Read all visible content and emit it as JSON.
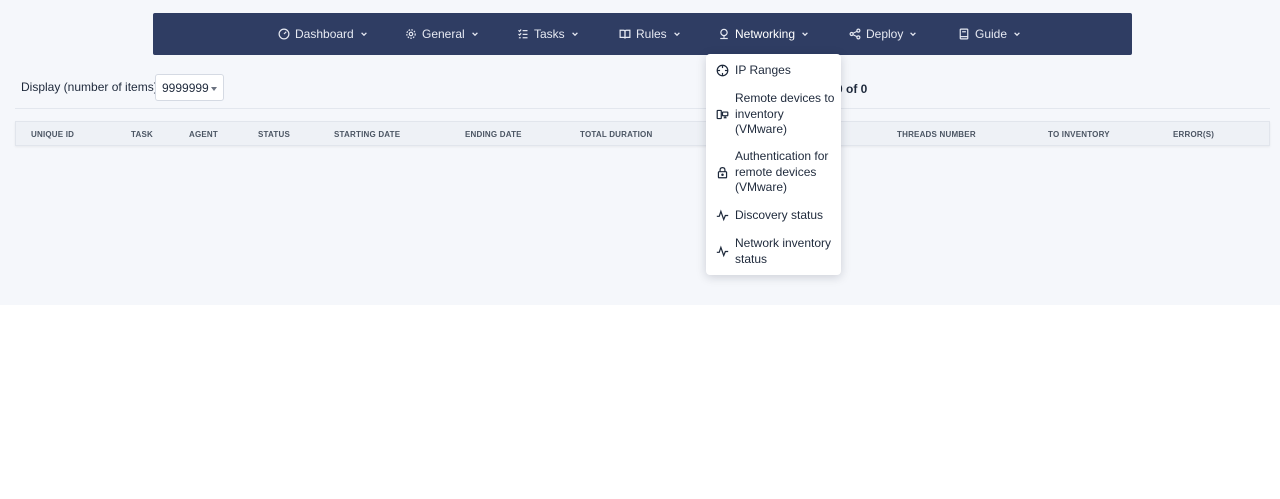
{
  "nav": {
    "items": [
      {
        "label": "Dashboard",
        "icon": "gauge-icon"
      },
      {
        "label": "General",
        "icon": "gear-icon"
      },
      {
        "label": "Tasks",
        "icon": "checklist-icon"
      },
      {
        "label": "Rules",
        "icon": "book-icon"
      },
      {
        "label": "Networking",
        "icon": "network-icon"
      },
      {
        "label": "Deploy",
        "icon": "share-icon"
      },
      {
        "label": "Guide",
        "icon": "guide-book-icon"
      }
    ],
    "active": "Networking"
  },
  "display": {
    "label": "Display (number of items)",
    "selected": "9999999"
  },
  "pager": {
    "text": "0 of 0"
  },
  "table": {
    "columns": [
      "UNIQUE ID",
      "TASK",
      "AGENT",
      "STATUS",
      "STARTING DATE",
      "ENDING DATE",
      "TOTAL DURATION",
      "THREADS NUMBER",
      "TO INVENTORY",
      "ERROR(S)"
    ]
  },
  "networking_menu": {
    "items": [
      {
        "label": "IP Ranges",
        "icon": "crosshair-icon"
      },
      {
        "label": "Remote devices to inventory (VMware)",
        "icon": "devices-icon"
      },
      {
        "label": "Authentication for remote devices (VMware)",
        "icon": "lock-icon"
      },
      {
        "label": "Discovery status",
        "icon": "activity-icon"
      },
      {
        "label": "Network inventory status",
        "icon": "activity-icon"
      }
    ]
  },
  "colors": {
    "navbar": "#2f3d63",
    "page_background": "#f5f7fb",
    "table_header": "#eef1f6"
  }
}
